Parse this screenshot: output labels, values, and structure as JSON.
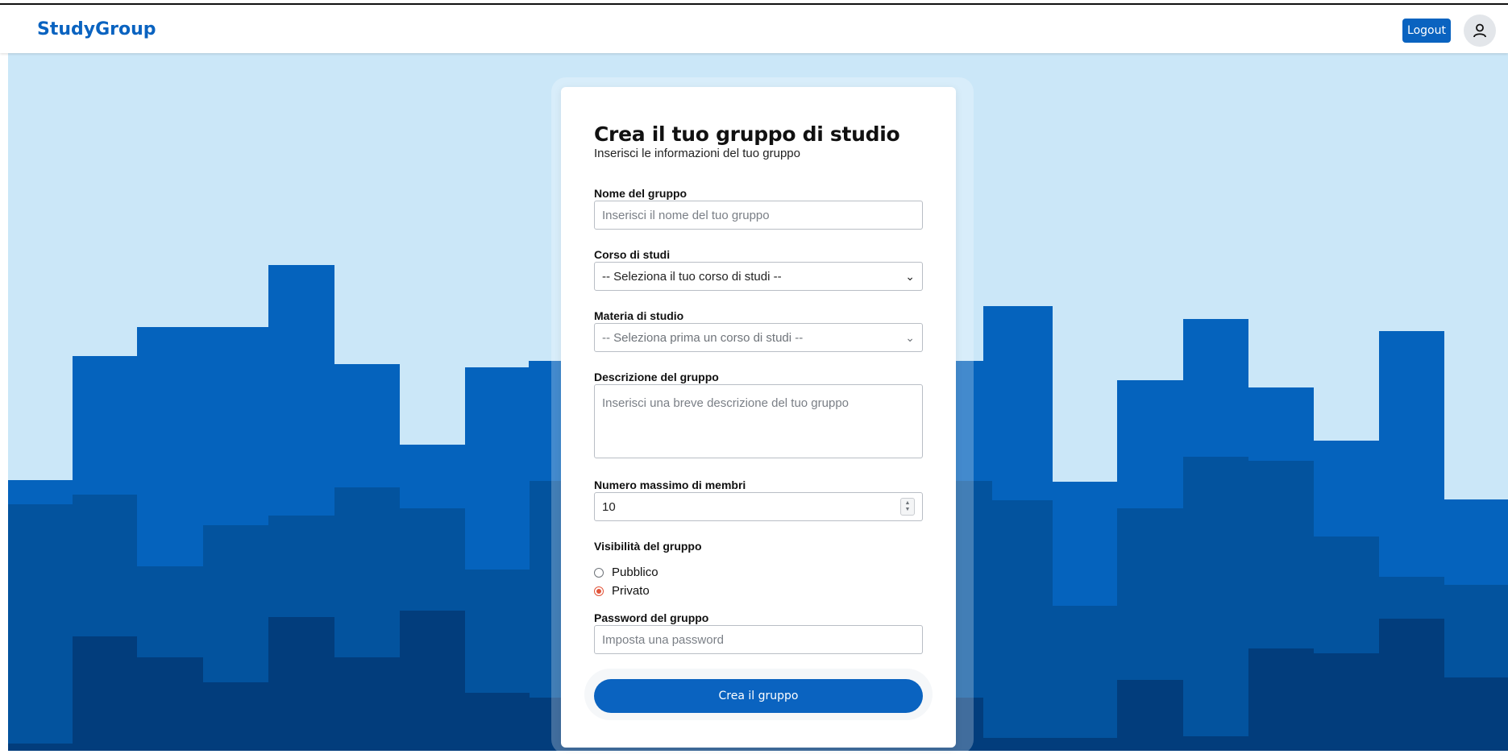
{
  "navbar": {
    "brand": "StudyGroup",
    "logout_label": "Logout"
  },
  "colors": {
    "brand": "#0a63c0",
    "sky": "#cbe7f8",
    "band1": "#0563bd",
    "band2": "#03539e",
    "band3": "#023d7c",
    "radio_accent": "#e2553b"
  },
  "form": {
    "title": "Crea il tuo gruppo di studio",
    "subtitle": "Inserisci le informazioni del tuo gruppo",
    "name": {
      "label": "Nome del gruppo",
      "placeholder": "Inserisci il nome del tuo gruppo",
      "value": ""
    },
    "course": {
      "label": "Corso di studi",
      "selected": "-- Seleziona il tuo corso di studi --"
    },
    "subject": {
      "label": "Materia di studio",
      "selected": "-- Seleziona prima un corso di studi --"
    },
    "description": {
      "label": "Descrizione del gruppo",
      "placeholder": "Inserisci una breve descrizione del tuo gruppo"
    },
    "max_members": {
      "label": "Numero massimo di membri",
      "value": "10"
    },
    "visibility": {
      "label": "Visibilità del gruppo",
      "options": [
        {
          "label": "Pubblico",
          "checked": false
        },
        {
          "label": "Privato",
          "checked": true
        }
      ]
    },
    "password": {
      "label": "Password del gruppo",
      "placeholder": "Imposta una password"
    },
    "submit_label": "Crea il gruppo"
  },
  "icons": {
    "avatar": "user-icon",
    "select": "chevron-down-icon",
    "spinner": "spinner-arrows-icon"
  }
}
